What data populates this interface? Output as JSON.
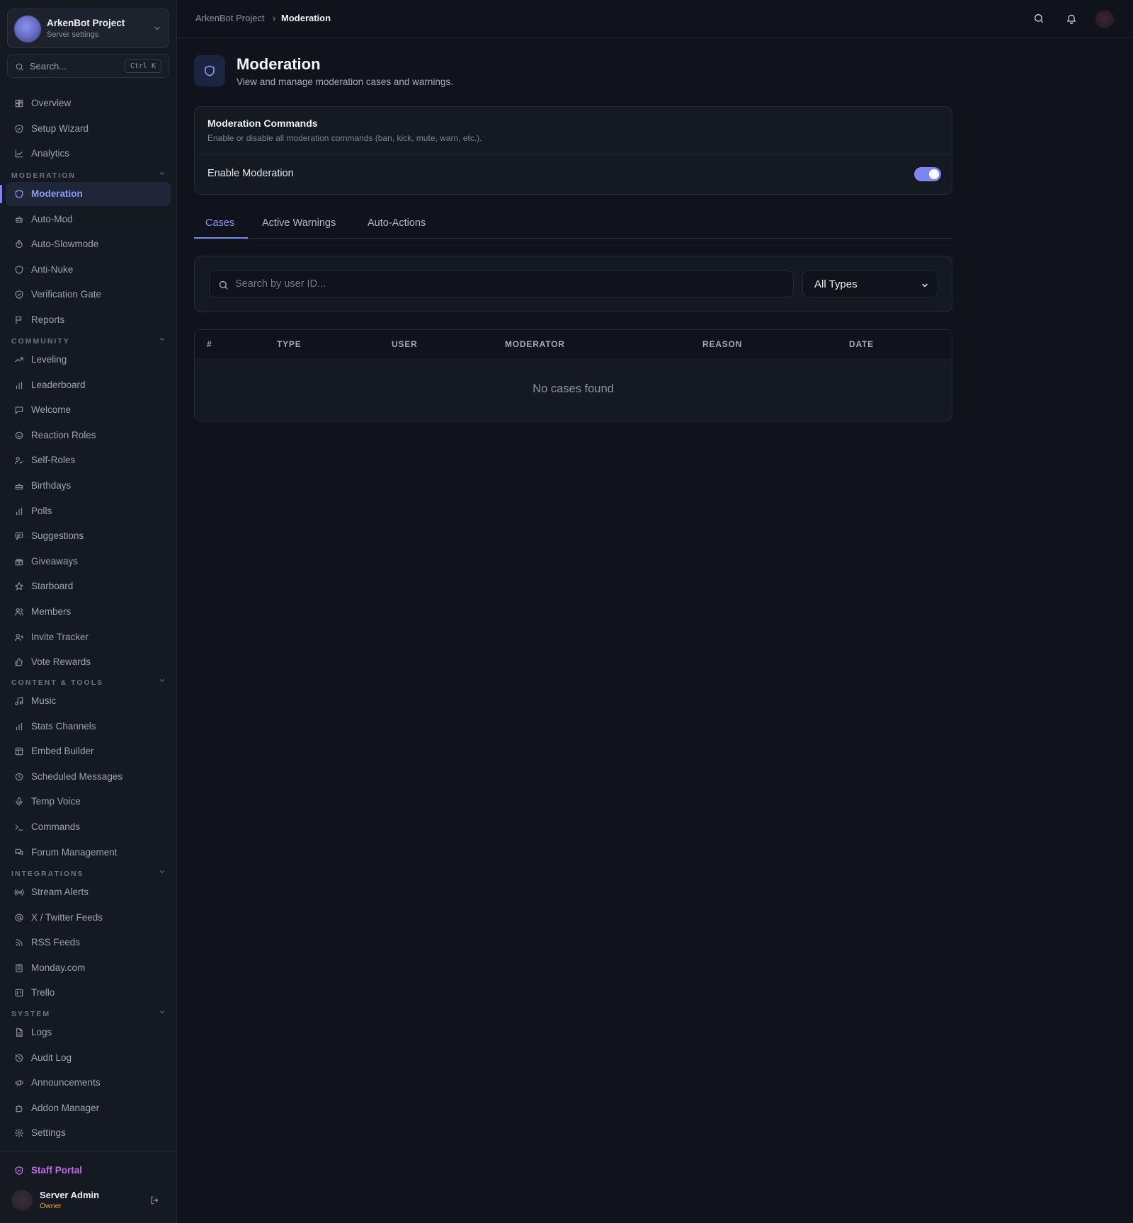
{
  "server": {
    "name": "ArkenBot Project",
    "subtitle": "Server settings"
  },
  "sidebar_search": {
    "placeholder": "Search...",
    "shortcut": "Ctrl K"
  },
  "nav_top": [
    {
      "label": "Overview",
      "icon": "grid-icon"
    },
    {
      "label": "Setup Wizard",
      "icon": "shield-check-icon"
    },
    {
      "label": "Analytics",
      "icon": "chart-line-icon"
    }
  ],
  "sections": {
    "moderation": {
      "title": "MODERATION",
      "items": [
        {
          "label": "Moderation",
          "icon": "shield-icon",
          "active": true
        },
        {
          "label": "Auto-Mod",
          "icon": "robot-icon"
        },
        {
          "label": "Auto-Slowmode",
          "icon": "timer-icon"
        },
        {
          "label": "Anti-Nuke",
          "icon": "shield-icon"
        },
        {
          "label": "Verification Gate",
          "icon": "shield-check-icon"
        },
        {
          "label": "Reports",
          "icon": "flag-icon"
        }
      ]
    },
    "community": {
      "title": "COMMUNITY",
      "items": [
        {
          "label": "Leveling",
          "icon": "trending-up-icon"
        },
        {
          "label": "Leaderboard",
          "icon": "bar-chart-icon"
        },
        {
          "label": "Welcome",
          "icon": "message-icon"
        },
        {
          "label": "Reaction Roles",
          "icon": "smile-icon"
        },
        {
          "label": "Self-Roles",
          "icon": "user-check-icon"
        },
        {
          "label": "Birthdays",
          "icon": "cake-icon"
        },
        {
          "label": "Polls",
          "icon": "bar-chart-icon"
        },
        {
          "label": "Suggestions",
          "icon": "message-square-icon"
        },
        {
          "label": "Giveaways",
          "icon": "gift-icon"
        },
        {
          "label": "Starboard",
          "icon": "star-icon"
        },
        {
          "label": "Members",
          "icon": "users-icon"
        },
        {
          "label": "Invite Tracker",
          "icon": "user-plus-icon"
        },
        {
          "label": "Vote Rewards",
          "icon": "thumbs-up-icon"
        }
      ]
    },
    "content": {
      "title": "CONTENT & TOOLS",
      "items": [
        {
          "label": "Music",
          "icon": "music-icon"
        },
        {
          "label": "Stats Channels",
          "icon": "bar-chart-icon"
        },
        {
          "label": "Embed Builder",
          "icon": "layout-icon"
        },
        {
          "label": "Scheduled Messages",
          "icon": "clock-icon"
        },
        {
          "label": "Temp Voice",
          "icon": "mic-icon"
        },
        {
          "label": "Commands",
          "icon": "terminal-icon"
        },
        {
          "label": "Forum Management",
          "icon": "messages-icon"
        }
      ]
    },
    "integrations": {
      "title": "INTEGRATIONS",
      "items": [
        {
          "label": "Stream Alerts",
          "icon": "radio-icon"
        },
        {
          "label": "X / Twitter Feeds",
          "icon": "at-sign-icon"
        },
        {
          "label": "RSS Feeds",
          "icon": "rss-icon"
        },
        {
          "label": "Monday.com",
          "icon": "clipboard-icon"
        },
        {
          "label": "Trello",
          "icon": "trello-icon"
        }
      ]
    },
    "system": {
      "title": "SYSTEM",
      "items": [
        {
          "label": "Logs",
          "icon": "file-text-icon"
        },
        {
          "label": "Audit Log",
          "icon": "history-icon"
        },
        {
          "label": "Announcements",
          "icon": "megaphone-icon"
        },
        {
          "label": "Addon Manager",
          "icon": "puzzle-icon"
        },
        {
          "label": "Settings",
          "icon": "gear-icon"
        }
      ]
    }
  },
  "staff_portal": {
    "label": "Staff Portal"
  },
  "user": {
    "name": "Server Admin",
    "role": "Owner"
  },
  "breadcrumb": {
    "parent": "ArkenBot Project",
    "separator": "›",
    "current": "Moderation"
  },
  "page": {
    "title": "Moderation",
    "subtitle": "View and manage moderation cases and warnings."
  },
  "commands_card": {
    "title": "Moderation Commands",
    "description": "Enable or disable all moderation commands (ban, kick, mute, warn, etc.).",
    "toggle_label": "Enable Moderation",
    "enabled": true
  },
  "tabs": [
    {
      "label": "Cases",
      "active": true
    },
    {
      "label": "Active Warnings"
    },
    {
      "label": "Auto-Actions"
    }
  ],
  "filters": {
    "search_placeholder": "Search by user ID...",
    "type_selected": "All Types"
  },
  "table": {
    "columns": [
      "#",
      "TYPE",
      "USER",
      "MODERATOR",
      "REASON",
      "DATE"
    ],
    "empty_text": "No cases found"
  },
  "colors": {
    "accent": "#7c85f0",
    "staff": "#c26cf0",
    "owner": "#e0a33b",
    "background": "#10131b"
  }
}
